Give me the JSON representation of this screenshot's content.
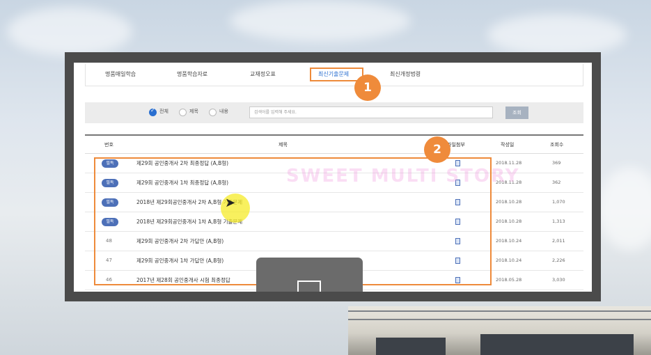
{
  "tabs": [
    {
      "label": "명품매일학습",
      "active": false
    },
    {
      "label": "명품학습자료",
      "active": false
    },
    {
      "label": "교재정오표",
      "active": false
    },
    {
      "label": "최신기출문제",
      "active": true
    },
    {
      "label": "최신개정법령",
      "active": false
    }
  ],
  "search": {
    "options": [
      "전체",
      "제목",
      "내용"
    ],
    "selected": "전체",
    "placeholder": "검색어를 입력해 주세요.",
    "button": "조회"
  },
  "table": {
    "headers": [
      "번호",
      "제목",
      "파일첨부",
      "작성일",
      "조회수"
    ],
    "rows": [
      {
        "num": "필독",
        "pinned": true,
        "title": "제29회 공인중개사 2차 최종정답 (A,B형)",
        "date": "2018.11.28",
        "views": "369"
      },
      {
        "num": "필독",
        "pinned": true,
        "title": "제29회 공인중개사 1차 최종정답 (A,B형)",
        "date": "2018.11.28",
        "views": "362"
      },
      {
        "num": "필독",
        "pinned": true,
        "title": "2018년 제29회공인중개사 2차 A,B형 기출문제",
        "date": "2018.10.28",
        "views": "1,070"
      },
      {
        "num": "필독",
        "pinned": true,
        "title": "2018년 제29회공인중개사 1차 A,B형 기출문제",
        "date": "2018.10.28",
        "views": "1,313"
      },
      {
        "num": "48",
        "pinned": false,
        "title": "제29회 공인중개사 2차 가답안 (A,B형)",
        "date": "2018.10.24",
        "views": "2,011"
      },
      {
        "num": "47",
        "pinned": false,
        "title": "제29회 공인중개사 1차 가답안 (A,B형)",
        "date": "2018.10.24",
        "views": "2,226"
      },
      {
        "num": "46",
        "pinned": false,
        "title": "2017년 제28회 공인중개사 시험 최종정답",
        "date": "2018.05.28",
        "views": "3,030"
      }
    ]
  },
  "annotations": {
    "step1": "1",
    "step2": "2",
    "accent_color": "#ee8a3a"
  },
  "watermark": "SWEET MULTI STORY"
}
